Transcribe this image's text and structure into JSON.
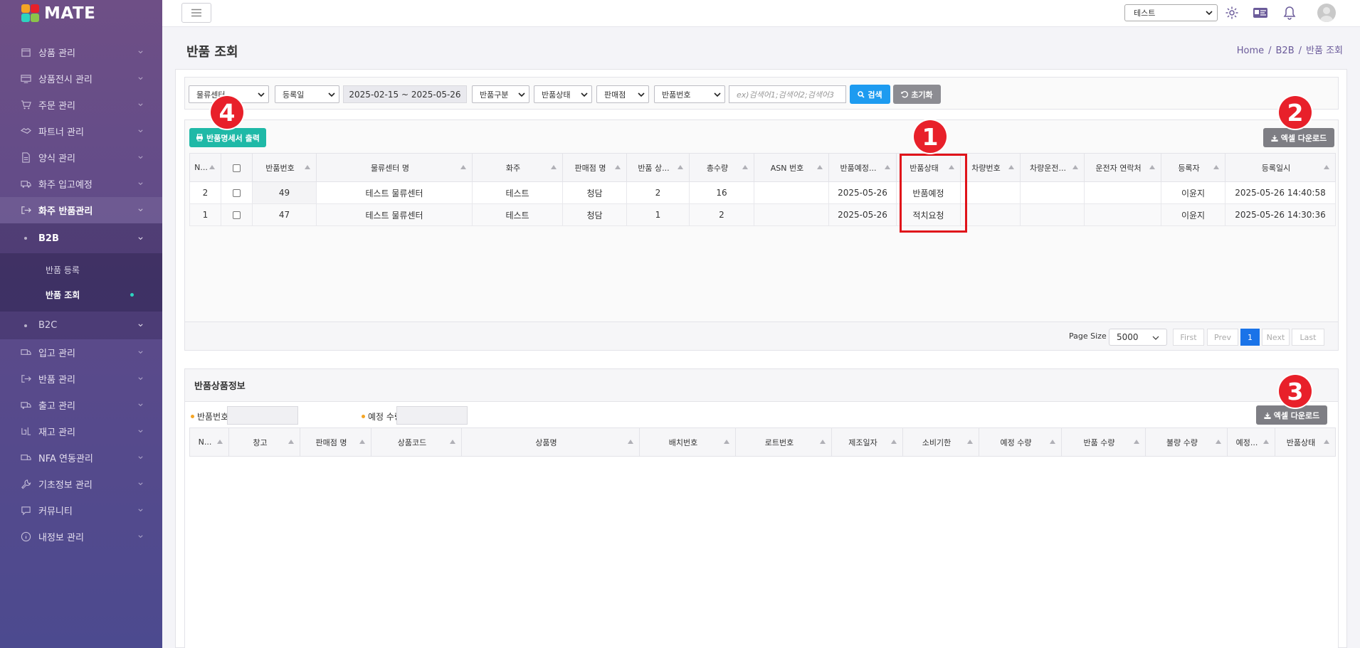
{
  "app": {
    "logo_text": "MATE"
  },
  "sidebar": {
    "items_top": [
      {
        "label": "상품 관리",
        "icon": "box-icon"
      },
      {
        "label": "상품전시 관리",
        "icon": "display-icon"
      },
      {
        "label": "주문 관리",
        "icon": "cart-icon"
      },
      {
        "label": "파트너 관리",
        "icon": "handshake-icon"
      },
      {
        "label": "양식 관리",
        "icon": "document-icon"
      },
      {
        "label": "화주 입고예정",
        "icon": "truck-icon"
      }
    ],
    "active_item": "화주 반품관리",
    "sub": {
      "b2b": "B2B",
      "b2c": "B2C"
    },
    "subsub": [
      "반품 등록",
      "반품 조회"
    ],
    "items_bottom": [
      {
        "label": "입고 관리"
      },
      {
        "label": "반품 관리"
      },
      {
        "label": "출고 관리"
      },
      {
        "label": "재고 관리"
      },
      {
        "label": "NFA 연동관리"
      },
      {
        "label": "기초정보 관리"
      },
      {
        "label": "커뮤니티"
      },
      {
        "label": "내정보 관리"
      }
    ]
  },
  "topbar": {
    "select_value": "테스트"
  },
  "page": {
    "title": "반품 조회",
    "breadcrumb": [
      "Home",
      "B2B",
      "반품 조회"
    ]
  },
  "search": {
    "center_select": "물류센터",
    "date_type": "등록일",
    "date_range": "2025-02-15 ~ 2025-05-26",
    "return_type": "반품구분",
    "return_status": "반품상태",
    "store": "판매점",
    "field": "반품번호",
    "placeholder": "ex)검색어1;검색어2;검색어3",
    "search_btn": "검색",
    "reset_btn": "초기화"
  },
  "actions": {
    "print_btn": "반품명세서 출력",
    "excel_btn": "엑셀 다운로드"
  },
  "grid": {
    "columns": [
      "N...",
      "",
      "반품번호",
      "물류센터 명",
      "화주",
      "판매점 명",
      "반품 상...",
      "총수량",
      "ASN 번호",
      "반품예정...",
      "반품상태",
      "차량번호",
      "차량운전...",
      "운전자 연락처",
      "등록자",
      "등록일시"
    ],
    "rows": [
      [
        "2",
        "",
        "49",
        "테스트 물류센터",
        "테스트",
        "청담",
        "2",
        "16",
        "",
        "2025-05-26",
        "반품예정",
        "",
        "",
        "",
        "이윤지",
        "2025-05-26 14:40:58"
      ],
      [
        "1",
        "",
        "47",
        "테스트 물류센터",
        "테스트",
        "청담",
        "1",
        "2",
        "",
        "2025-05-26",
        "적치요청",
        "",
        "",
        "",
        "이윤지",
        "2025-05-26 14:30:36"
      ]
    ]
  },
  "pager": {
    "page_size_label": "Page Size",
    "page_size": "5000",
    "first": "First",
    "prev": "Prev",
    "current": "1",
    "next": "Next",
    "last": "Last"
  },
  "detail": {
    "title": "반품상품정보",
    "field1": "반품번호",
    "field2": "예정 수량",
    "columns": [
      "N...",
      "창고",
      "판매점 명",
      "상품코드",
      "상품명",
      "배치번호",
      "로트번호",
      "제조일자",
      "소비기한",
      "예정 수량",
      "반품 수량",
      "불량 수량",
      "예정...",
      "반품상태"
    ]
  },
  "callouts": [
    "1",
    "2",
    "3",
    "4"
  ],
  "colors": {
    "accent_red": "#e8202a",
    "teal": "#1fb9a7",
    "blue": "#1d9bf0",
    "page_blue": "#1a73e8"
  }
}
